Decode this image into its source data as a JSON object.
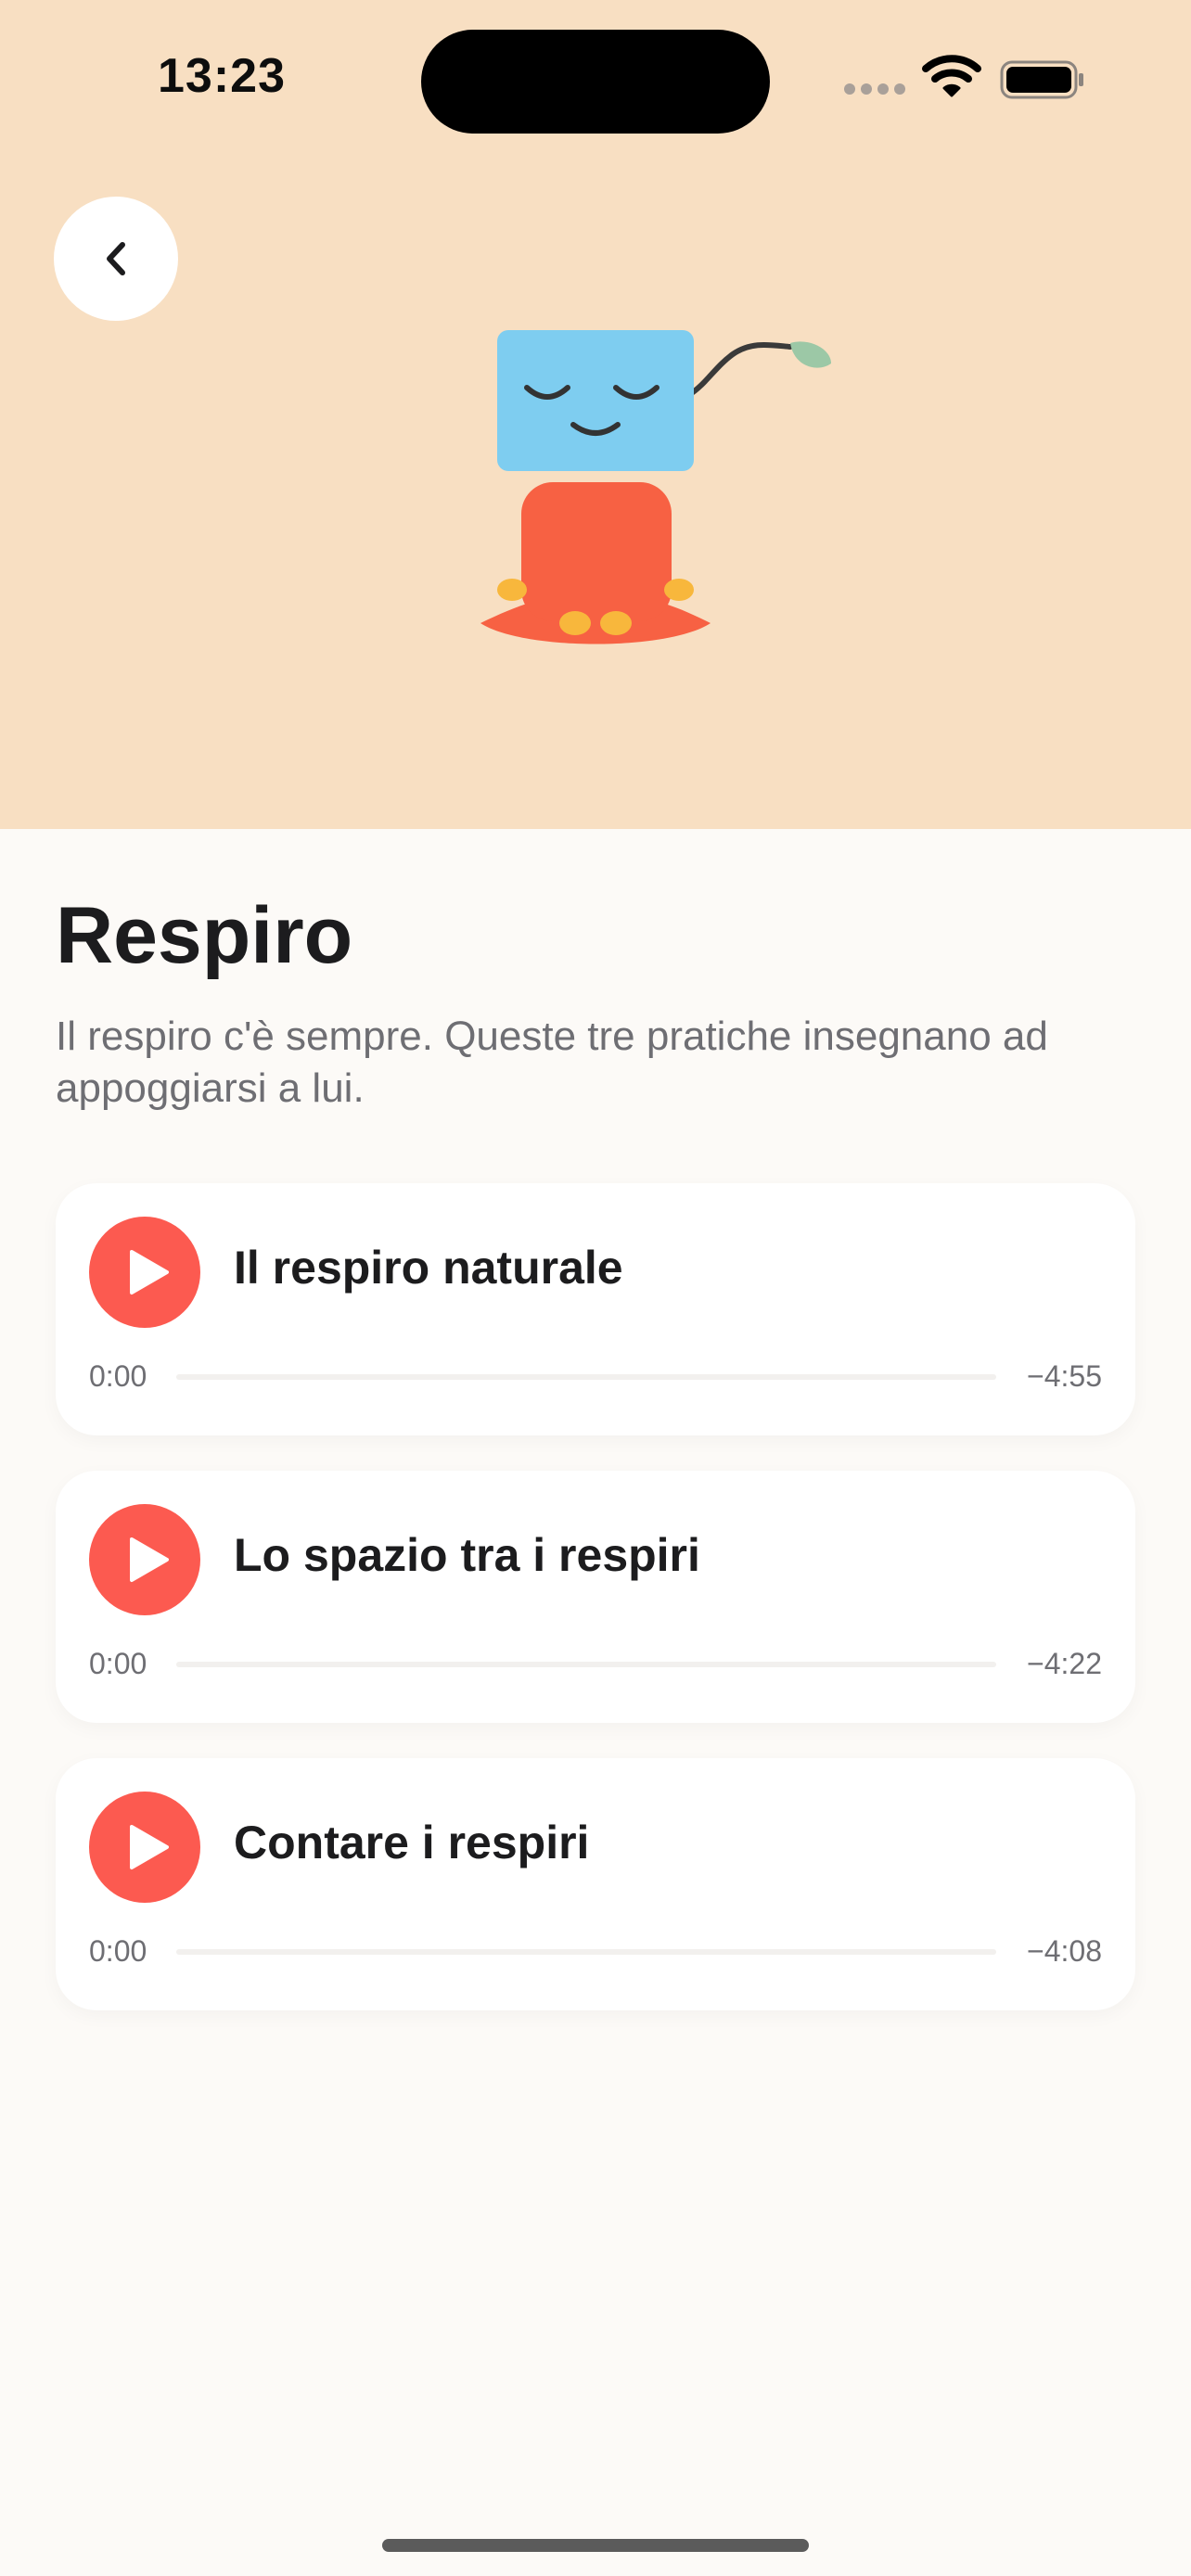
{
  "status_bar": {
    "time": "13:23",
    "signal_icon": "cellular-signal-icon",
    "wifi_icon": "wifi-icon",
    "battery_icon": "battery-full-icon"
  },
  "header": {
    "background_color": "#f8dfc2",
    "back_icon": "chevron-left-icon",
    "illustration": "meditating-mascot"
  },
  "main": {
    "title": "Respiro",
    "subtitle": "Il respiro c'è sempre. Queste tre pratiche insegnano ad appoggiarsi a lui."
  },
  "tracks": [
    {
      "title": "Il respiro naturale",
      "elapsed": "0:00",
      "remaining": "−4:55",
      "progress": 0
    },
    {
      "title": "Lo spazio tra i respiri",
      "elapsed": "0:00",
      "remaining": "−4:22",
      "progress": 0
    },
    {
      "title": "Contare i respiri",
      "elapsed": "0:00",
      "remaining": "−4:08",
      "progress": 0
    }
  ],
  "colors": {
    "accent": "#fc5a50",
    "header_bg": "#f8dfc2",
    "page_bg": "#fcfaf7",
    "mascot_head": "#7ecdf0",
    "mascot_body": "#f76143",
    "mascot_feet": "#f8b73c",
    "mascot_leaf": "#9cc8a6"
  }
}
